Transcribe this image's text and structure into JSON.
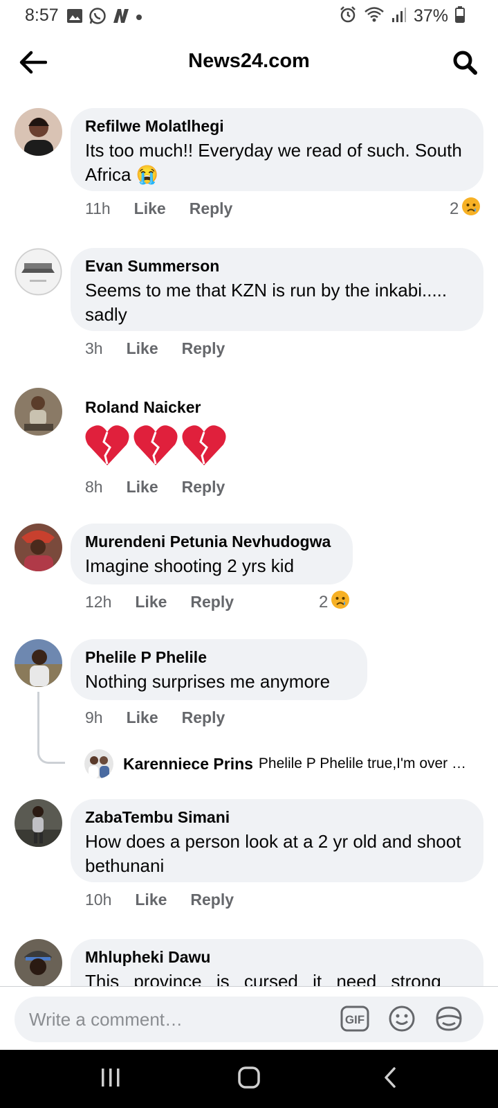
{
  "status_bar": {
    "time": "8:57",
    "battery": "37%",
    "left_icons": [
      "gallery-icon",
      "whatsapp-icon",
      "news-app-icon",
      "notification-dot-icon"
    ],
    "right_icons": [
      "alarm-icon",
      "wifi-icon",
      "signal-icon",
      "battery-icon"
    ]
  },
  "app_bar": {
    "title": "News24.com",
    "back_icon": "arrow-left-icon",
    "search_icon": "search-icon"
  },
  "comments": [
    {
      "author": "Refilwe Molatlhegi",
      "text": "Its too much!! Everyday we read of such. South Africa 😭",
      "time": "11h",
      "like": "Like",
      "reply": "Reply",
      "reaction_count": "2",
      "reaction_icon": "sad-reaction-icon"
    },
    {
      "author": "Evan Summerson",
      "text": "Seems to me that KZN is run by the inkabi..... sadly",
      "time": "3h",
      "like": "Like",
      "reply": "Reply"
    },
    {
      "author": "Roland Naicker",
      "text": "💔💔💔",
      "time": "8h",
      "like": "Like",
      "reply": "Reply"
    },
    {
      "author": "Murendeni Petunia Nevhudogwa",
      "text": "Imagine shooting 2 yrs kid",
      "time": "12h",
      "like": "Like",
      "reply": "Reply",
      "reaction_count": "2",
      "reaction_icon": "sad-reaction-icon"
    },
    {
      "author": "Phelile P Phelile",
      "text": "Nothing surprises me anymore",
      "time": "9h",
      "like": "Like",
      "reply": "Reply",
      "reply_preview": {
        "author": "Karenniece Prins",
        "text": "Phelile P Phelile true,I'm over …"
      }
    },
    {
      "author": "ZabaTembu Simani",
      "text": "How does a person look at a 2 yr old and shoot bethunani",
      "time": "10h",
      "like": "Like",
      "reply": "Reply"
    },
    {
      "author": "Mhlupheki Dawu",
      "text": "This province is cursed it need strong"
    }
  ],
  "composer": {
    "placeholder": "Write a comment…",
    "icons": [
      "gif-icon",
      "emoji-icon",
      "sticker-icon"
    ]
  },
  "nav_bar": {
    "icons": [
      "recent-apps-icon",
      "home-icon",
      "back-nav-icon"
    ]
  },
  "colors": {
    "bubble": "#f0f2f5",
    "meta_text": "#65676b",
    "reaction_yellow": "#f7b125",
    "nav_bg": "#000000"
  }
}
